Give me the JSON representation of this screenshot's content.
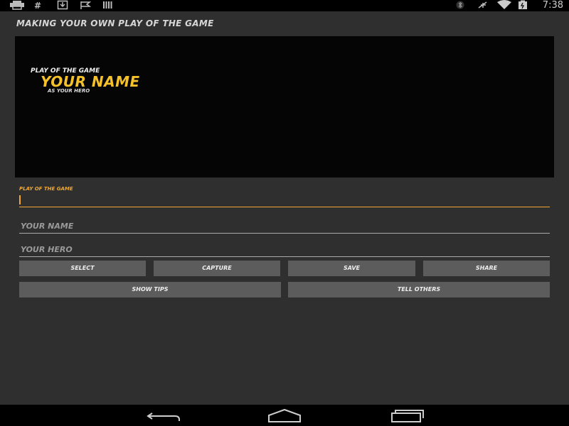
{
  "status_bar": {
    "time": "7:38",
    "left_icons": [
      "printer-icon",
      "hash-icon",
      "download-icon",
      "flag-icon",
      "barcode-icon"
    ],
    "right_icons": [
      "bluetooth-icon",
      "airplane-mute-icon",
      "wifi-icon",
      "battery-icon"
    ]
  },
  "page": {
    "title": "MAKING YOUR OWN PLAY OF THE GAME"
  },
  "preview": {
    "line1": "PLAY OF THE GAME",
    "name": "YOUR NAME",
    "line3": "AS YOUR HERO",
    "name_color": "#f5c12a"
  },
  "form": {
    "field1_label": "PLAY OF THE GAME",
    "field1_value": "",
    "field2_placeholder": "YOUR NAME",
    "field3_placeholder": "YOUR HERO"
  },
  "buttons": {
    "select": "SELECT",
    "capture": "CAPTURE",
    "save": "SAVE",
    "share": "SHARE",
    "show_tips": "SHOW TIPS",
    "tell_others": "TELL OTHERS"
  },
  "colors": {
    "accent": "#f0a830",
    "background": "#2f2f2f",
    "button": "#5c5c5c"
  }
}
